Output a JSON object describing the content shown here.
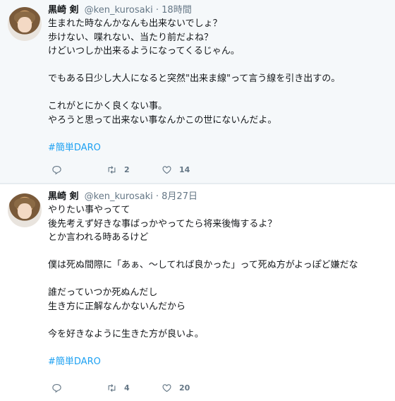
{
  "tweets": [
    {
      "name": "黒崎 剣",
      "handle": "@ken_kurosaki",
      "dot": "·",
      "time": "18時間",
      "lines": [
        "生まれた時なんかなんも出来ないでしょ？",
        "歩けない、喋れない、当たり前だよね？",
        "けどいつしか出来るようになってくるじゃん。",
        "",
        "でもある日少し大人になると突然\"出来ま線\"って言う線を引き出すの。",
        "",
        "これがとにかく良くない事。",
        "やろうと思って出来ない事なんかこの世にないんだよ。",
        ""
      ],
      "hashtag": "#簡単DARO",
      "retweets": "2",
      "likes": "14"
    },
    {
      "name": "黒崎 剣",
      "handle": "@ken_kurosaki",
      "dot": "·",
      "time": "8月27日",
      "lines": [
        "やりたい事やってて",
        "後先考えず好きな事ばっかやってたら将来後悔するよ？",
        "とか言われる時あるけど",
        "",
        "僕は死ぬ間際に「あぁ、〜してれば良かった」って死ぬ方がよっぽど嫌だな",
        "",
        "誰だっていつか死ぬんだし",
        "生き方に正解なんかないんだから",
        "",
        "今を好きなように生きた方が良いよ。",
        ""
      ],
      "hashtag": "#簡単DARO",
      "retweets": "4",
      "likes": "20"
    }
  ],
  "icons": {
    "reply": "reply-icon",
    "retweet": "retweet-icon",
    "like": "heart-icon"
  },
  "colors": {
    "accent": "#1da1f2",
    "muted": "#657786",
    "text": "#14171a",
    "highlight_bg": "#f5f8fa"
  }
}
